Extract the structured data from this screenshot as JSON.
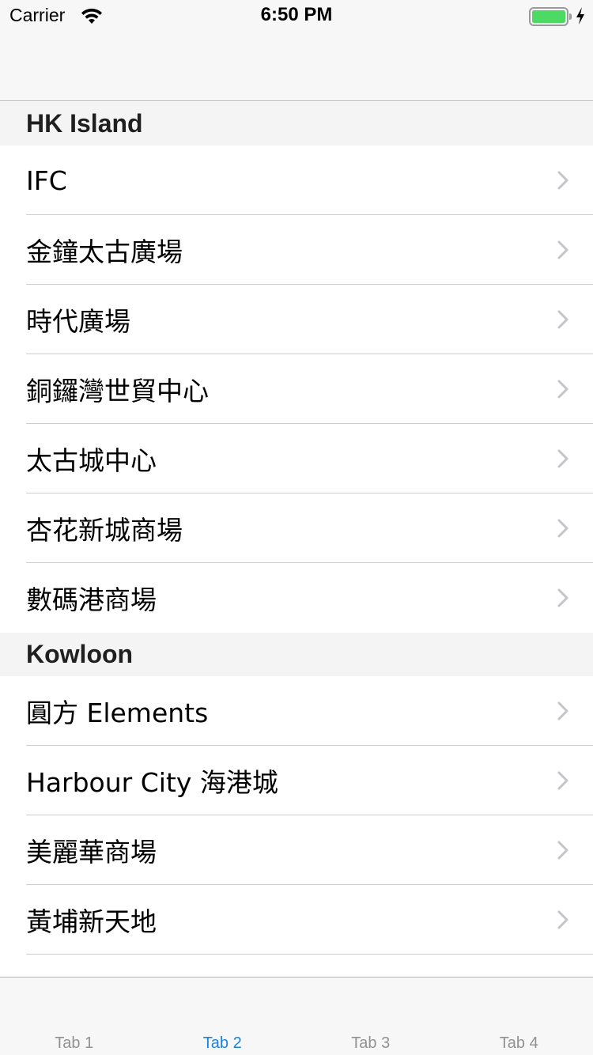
{
  "status_bar": {
    "carrier": "Carrier",
    "time": "6:50 PM"
  },
  "sections": [
    {
      "title": "HK Island",
      "items": [
        "IFC",
        "金鐘太古廣場",
        "時代廣場",
        "銅鑼灣世貿中心",
        "太古城中心",
        "杏花新城商場",
        "數碼港商場"
      ]
    },
    {
      "title": "Kowloon",
      "items": [
        "圓方 Elements",
        "Harbour City 海港城",
        "美麗華商場",
        "黃埔新天地",
        ""
      ]
    }
  ],
  "tabs": [
    {
      "label": "Tab 1",
      "active": false
    },
    {
      "label": "Tab 2",
      "active": true
    },
    {
      "label": "Tab 3",
      "active": false
    },
    {
      "label": "Tab 4",
      "active": false
    }
  ],
  "colors": {
    "accent": "#1a82e0",
    "battery": "#4cd964",
    "chevron": "#c4c4c9"
  },
  "icons": {
    "status": [
      "wifi-icon",
      "battery-icon",
      "charging-bolt-icon"
    ],
    "row": "chevron-right-icon"
  }
}
